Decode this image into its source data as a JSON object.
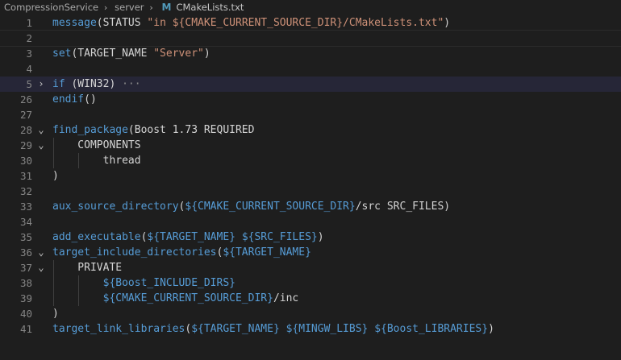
{
  "breadcrumb": {
    "items": [
      "CompressionService",
      "server"
    ],
    "file_icon": "M",
    "file_name": "CMakeLists.txt"
  },
  "lines": [
    {
      "num": "1",
      "tokens": [
        [
          "fn",
          "message"
        ],
        [
          "plain",
          "(STATUS "
        ],
        [
          "str",
          "\"in ${CMAKE_CURRENT_SOURCE_DIR}/CMakeLists.txt\""
        ],
        [
          "plain",
          ")"
        ]
      ]
    },
    {
      "num": "2",
      "tokens": []
    },
    {
      "num": "3",
      "tokens": [
        [
          "fn",
          "set"
        ],
        [
          "plain",
          "(TARGET_NAME "
        ],
        [
          "str",
          "\"Server\""
        ],
        [
          "plain",
          ")"
        ]
      ]
    },
    {
      "num": "4",
      "tokens": []
    },
    {
      "num": "5",
      "fold": "›",
      "tokens": [
        [
          "fn",
          "if"
        ],
        [
          "plain",
          " (WIN32)"
        ],
        [
          "ellipsis",
          " ···"
        ]
      ]
    },
    {
      "num": "26",
      "tokens": [
        [
          "fn",
          "endif"
        ],
        [
          "plain",
          "()"
        ]
      ]
    },
    {
      "num": "27",
      "tokens": []
    },
    {
      "num": "28",
      "fold": "⌄",
      "tokens": [
        [
          "fn",
          "find_package"
        ],
        [
          "plain",
          "(Boost 1.73 REQUIRED"
        ]
      ]
    },
    {
      "num": "29",
      "fold": "⌄",
      "tokens": [
        [
          "plain",
          "    COMPONENTS"
        ]
      ]
    },
    {
      "num": "30",
      "tokens": [
        [
          "plain",
          "        thread"
        ]
      ]
    },
    {
      "num": "31",
      "tokens": [
        [
          "plain",
          ")"
        ]
      ]
    },
    {
      "num": "32",
      "tokens": []
    },
    {
      "num": "33",
      "tokens": [
        [
          "fn",
          "aux_source_directory"
        ],
        [
          "plain",
          "("
        ],
        [
          "var",
          "${CMAKE_CURRENT_SOURCE_DIR}"
        ],
        [
          "plain",
          "/src SRC_FILES)"
        ]
      ]
    },
    {
      "num": "34",
      "tokens": []
    },
    {
      "num": "35",
      "tokens": [
        [
          "fn",
          "add_executable"
        ],
        [
          "plain",
          "("
        ],
        [
          "var",
          "${TARGET_NAME}"
        ],
        [
          "plain",
          " "
        ],
        [
          "var",
          "${SRC_FILES}"
        ],
        [
          "plain",
          ")"
        ]
      ]
    },
    {
      "num": "36",
      "fold": "⌄",
      "tokens": [
        [
          "fn",
          "target_include_directories"
        ],
        [
          "plain",
          "("
        ],
        [
          "var",
          "${TARGET_NAME}"
        ]
      ]
    },
    {
      "num": "37",
      "fold": "⌄",
      "tokens": [
        [
          "plain",
          "    PRIVATE"
        ]
      ]
    },
    {
      "num": "38",
      "tokens": [
        [
          "plain",
          "        "
        ],
        [
          "var",
          "${Boost_INCLUDE_DIRS}"
        ]
      ]
    },
    {
      "num": "39",
      "tokens": [
        [
          "plain",
          "        "
        ],
        [
          "var",
          "${CMAKE_CURRENT_SOURCE_DIR}"
        ],
        [
          "plain",
          "/inc"
        ]
      ]
    },
    {
      "num": "40",
      "tokens": [
        [
          "plain",
          ")"
        ]
      ]
    },
    {
      "num": "41",
      "tokens": [
        [
          "fn",
          "target_link_libraries"
        ],
        [
          "plain",
          "("
        ],
        [
          "var",
          "${TARGET_NAME}"
        ],
        [
          "plain",
          " "
        ],
        [
          "var",
          "${MINGW_LIBS}"
        ],
        [
          "plain",
          " "
        ],
        [
          "var",
          "${Boost_LIBRARIES}"
        ],
        [
          "plain",
          ")"
        ]
      ]
    }
  ],
  "colors": {
    "background": "#1e1e1e",
    "keyword": "#569cd6",
    "string": "#ce9178",
    "text": "#d4d4d4",
    "line_number": "#858585",
    "current_line": "#262637"
  }
}
